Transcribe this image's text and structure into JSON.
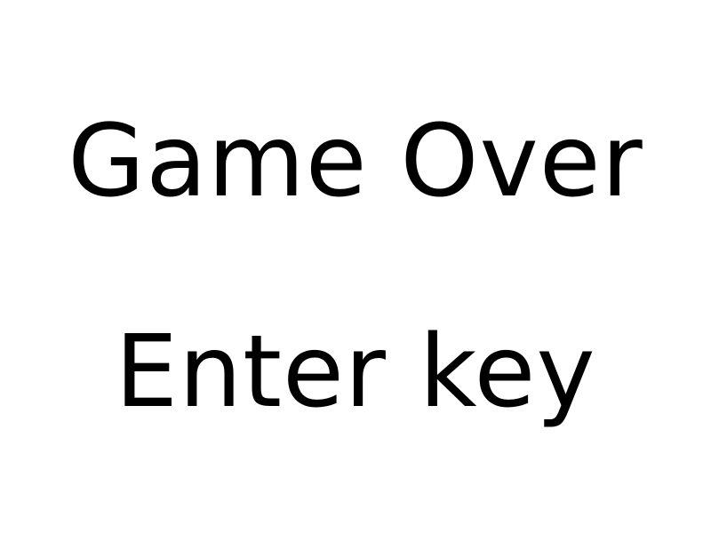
{
  "screen": {
    "title": "Game Over",
    "prompt": "Enter key"
  },
  "colors": {
    "background": "#ffffff",
    "text": "#000000"
  }
}
